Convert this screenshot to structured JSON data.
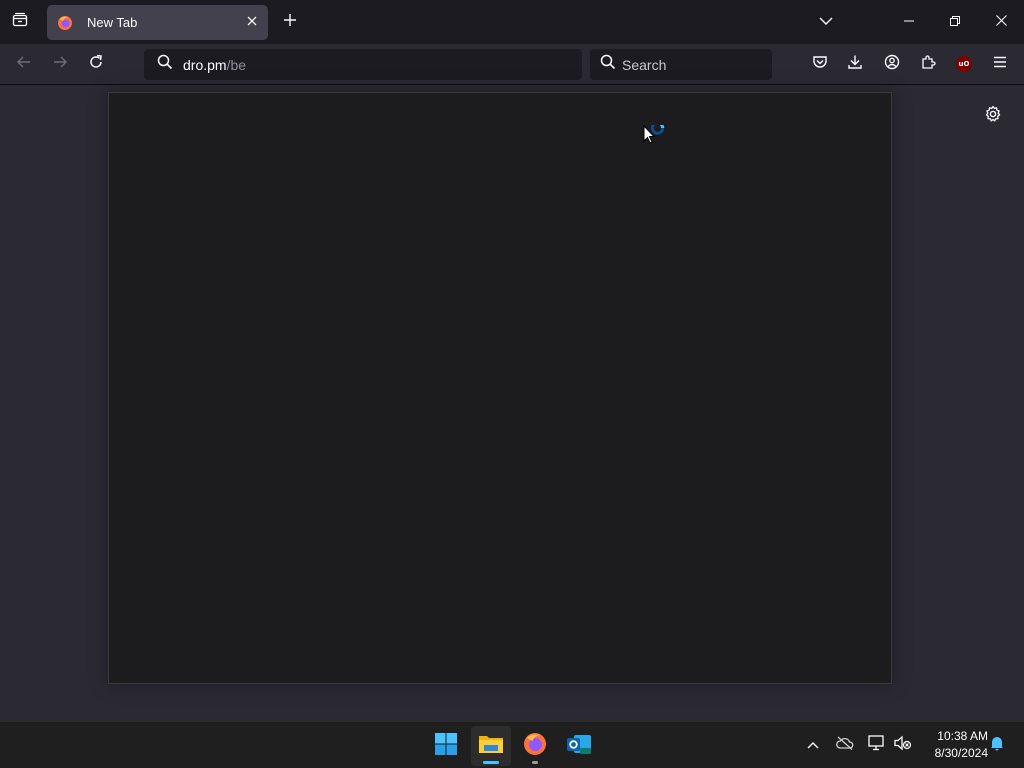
{
  "tab": {
    "title": "New Tab",
    "close_label": "×"
  },
  "urlbar": {
    "host": "dro.pm",
    "path": "/be"
  },
  "search": {
    "placeholder": "Search"
  },
  "taskbar": {
    "time": "10:38 AM",
    "date": "8/30/2024"
  },
  "colors": {
    "accent": "#4cc2ff",
    "spinner": "#1e90ff",
    "ublock": "#800000"
  },
  "icons": {
    "tabstrip": [
      "tab-manager-icon",
      "firefox-icon",
      "close-icon",
      "plus-icon",
      "chevron-down-icon",
      "minimize-icon",
      "restore-icon",
      "close-window-icon"
    ],
    "navbar": [
      "back-icon",
      "forward-icon",
      "reload-icon",
      "search-icon",
      "pocket-icon",
      "download-icon",
      "account-icon",
      "extensions-icon",
      "ublock-icon",
      "menu-icon"
    ],
    "content": [
      "gear-icon",
      "cursor-busy-icon"
    ],
    "taskbar": [
      "windows-start-icon",
      "file-explorer-icon",
      "firefox-icon",
      "outlook-new-icon",
      "chevron-up-icon",
      "onedrive-icon",
      "network-icon",
      "volume-muted-icon",
      "bell-icon"
    ]
  }
}
